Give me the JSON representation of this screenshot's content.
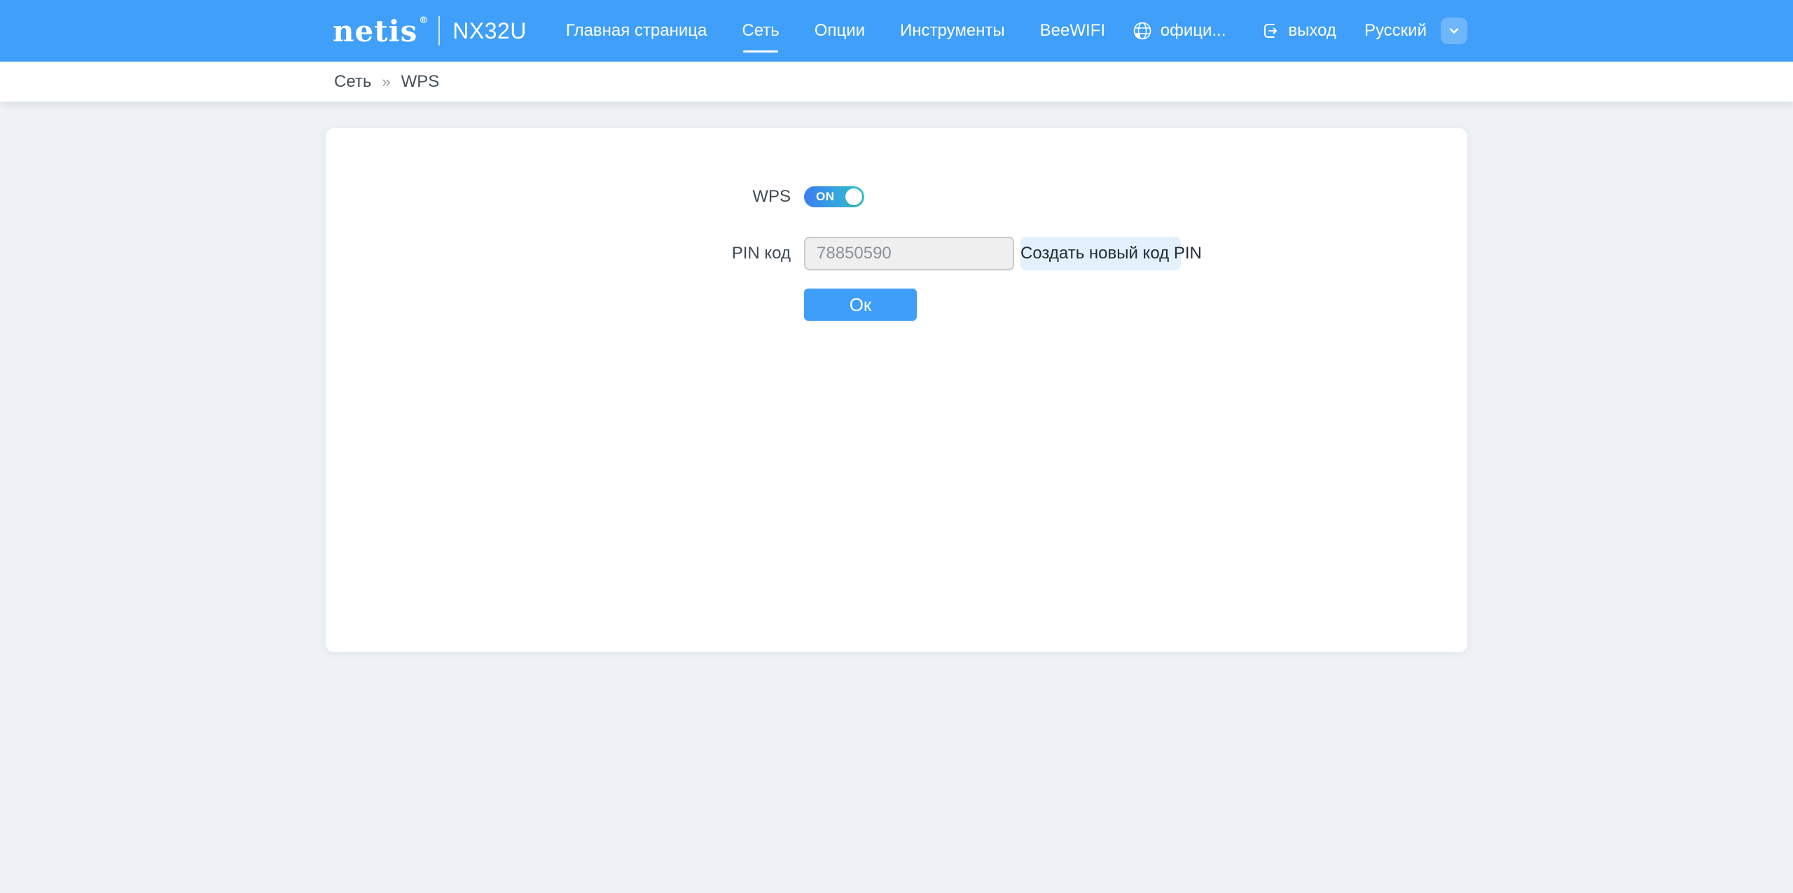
{
  "header": {
    "brand": "netis",
    "brand_reg": "®",
    "model": "NX32U",
    "nav": [
      {
        "label": "Главная страница",
        "active": false
      },
      {
        "label": "Сеть",
        "active": true
      },
      {
        "label": "Опции",
        "active": false
      },
      {
        "label": "Инструменты",
        "active": false
      },
      {
        "label": "BeeWIFI",
        "active": false
      }
    ],
    "official_label": "офици...",
    "logout_label": "выход",
    "language_selected": "Русский"
  },
  "breadcrumb": {
    "section": "Сеть",
    "separator": "»",
    "page": "WPS"
  },
  "form": {
    "wps_label": "WPS",
    "wps_state": "ON",
    "pin_label": "PIN код",
    "pin_value": "78850590",
    "create_pin_label": "Создать новый код PIN",
    "ok_label": "Ок"
  },
  "icons": {
    "globe": "globe-icon",
    "logout": "logout-icon",
    "chevron": "chevron-down-icon"
  },
  "colors": {
    "header_bg": "#3f9ff9",
    "page_bg": "#eef1f5",
    "accent_blue": "#3f9ef9",
    "toggle_gradient_start": "#3d7df2",
    "toggle_gradient_end": "#2ec7c9",
    "create_btn_bg": "#e2f1fd",
    "input_bg": "#efefef",
    "input_border": "#c6cacd",
    "text_dark": "#3f4a54"
  }
}
